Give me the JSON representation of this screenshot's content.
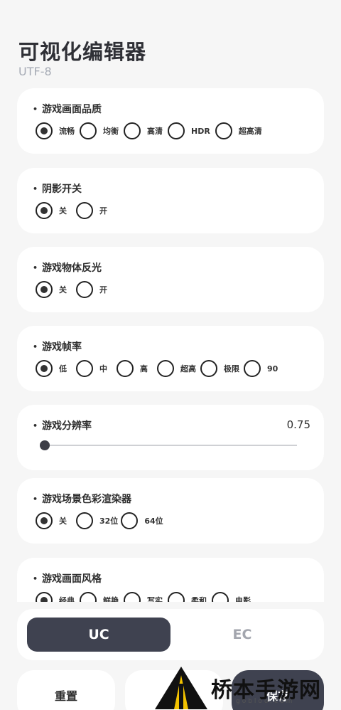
{
  "header": {
    "title": "可视化编辑器",
    "subtitle": "UTF-8"
  },
  "settings": [
    {
      "label": "游戏画面品质",
      "options": [
        "流畅",
        "均衡",
        "高清",
        "HDR",
        "超高清"
      ],
      "selected": 0
    },
    {
      "label": "阴影开关",
      "options": [
        "关",
        "开"
      ],
      "selected": 0
    },
    {
      "label": "游戏物体反光",
      "options": [
        "关",
        "开"
      ],
      "selected": 0
    },
    {
      "label": "游戏帧率",
      "options": [
        "低",
        "中",
        "高",
        "超高",
        "极限",
        "90"
      ],
      "selected": 0
    },
    {
      "label": "游戏分辨率",
      "type": "slider",
      "value": "0.75",
      "fraction": 0.0
    },
    {
      "label": "游戏场景色彩渲染器",
      "options": [
        "关",
        "32位",
        "64位"
      ],
      "selected": 0
    },
    {
      "label": "游戏画面风格",
      "options": [
        "经典",
        "鲜艳",
        "写实",
        "柔和",
        "电影"
      ],
      "selected": 0
    }
  ],
  "mode_switch": {
    "active": "UC",
    "inactive": "EC"
  },
  "actions": {
    "reset": "重置",
    "save": "保存"
  },
  "watermark": {
    "text": "桥本手游网",
    "url": "gobloo.com"
  },
  "colors": {
    "accent": "#3f4250",
    "background": "#f6f6f6",
    "card": "#ffffff"
  }
}
